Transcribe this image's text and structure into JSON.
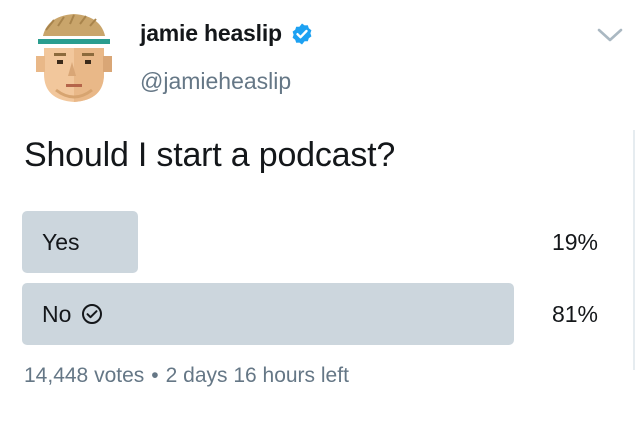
{
  "author": {
    "display_name": "jamie heaslip",
    "handle": "@jamieheaslip",
    "verified": true,
    "avatar_icon": "cartoon-avatar-headband-icon",
    "verified_icon": "verified-badge-icon"
  },
  "menu_icon": "chevron-down-icon",
  "tweet": {
    "text": "Should I start a podcast?"
  },
  "poll": {
    "options": [
      {
        "label": "Yes",
        "percent_text": "19%",
        "percent": 19,
        "selected": false
      },
      {
        "label": "No",
        "percent_text": "81%",
        "percent": 81,
        "selected": true,
        "selected_icon": "check-circle-icon"
      }
    ],
    "votes": "14,448 votes",
    "separator": "•",
    "time_left": "2 days 16 hours left"
  },
  "colors": {
    "bar": "#ccd6dd",
    "text": "#14171a",
    "secondary_text": "#657786",
    "verified_blue": "#1da1f2"
  }
}
